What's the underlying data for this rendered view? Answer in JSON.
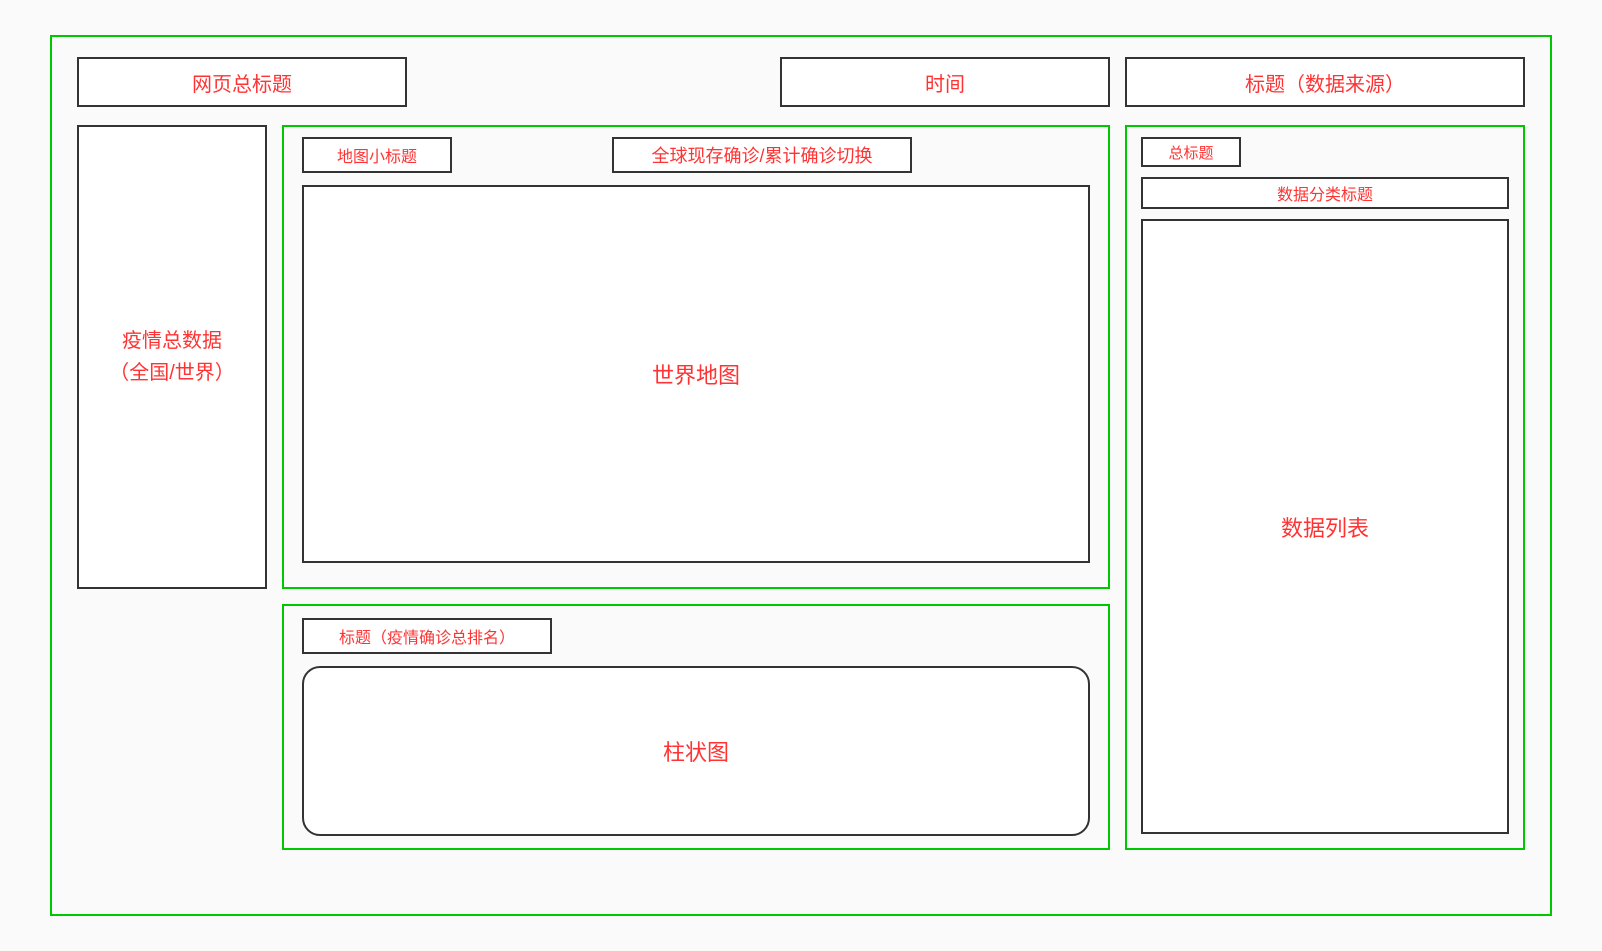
{
  "header": {
    "page_title": "网页总标题",
    "time": "时间",
    "data_source": "标题（数据来源）"
  },
  "left": {
    "summary": "疫情总数据\n（全国/世界）"
  },
  "map": {
    "subtitle": "地图小标题",
    "toggle_label": "全球现存确诊/累计确诊切换",
    "canvas_label": "世界地图"
  },
  "rank": {
    "title": "标题（疫情确诊总排名）",
    "chart_label": "柱状图"
  },
  "right": {
    "total_title": "总标题",
    "category_title": "数据分类标题",
    "list_label": "数据列表"
  }
}
